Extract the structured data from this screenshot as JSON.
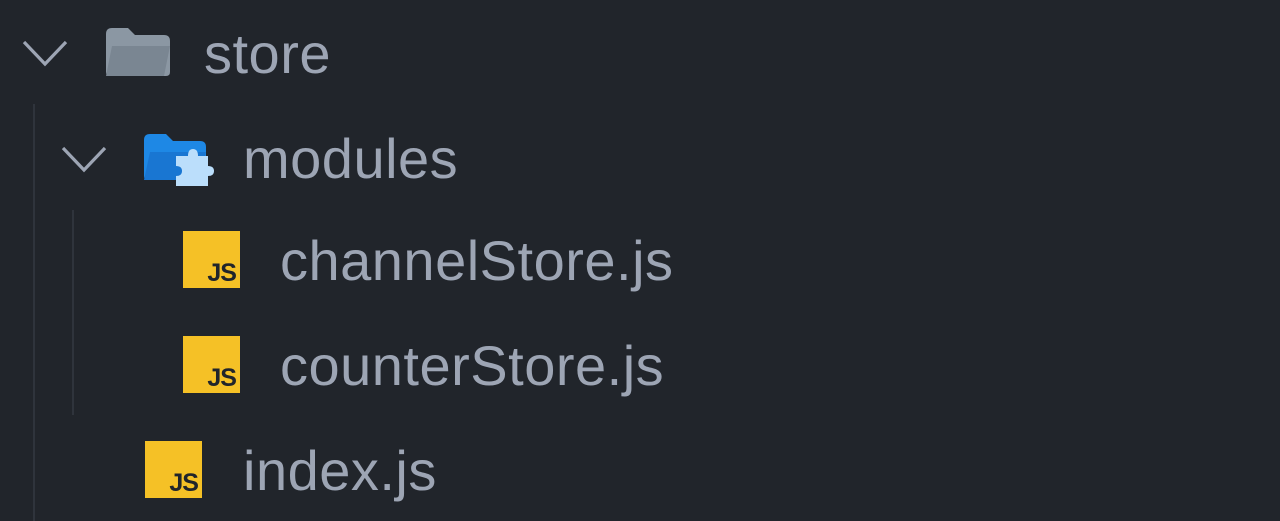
{
  "explorer": {
    "root": {
      "name": "store",
      "expanded": true,
      "icon": "folder-open-icon",
      "children": [
        {
          "name": "modules",
          "expanded": true,
          "icon": "folder-modules-icon",
          "children": [
            {
              "name": "channelStore.js",
              "icon": "js-file-icon",
              "badge": "JS"
            },
            {
              "name": "counterStore.js",
              "icon": "js-file-icon",
              "badge": "JS"
            }
          ]
        },
        {
          "name": "index.js",
          "icon": "js-file-icon",
          "badge": "JS"
        }
      ]
    }
  },
  "colors": {
    "background": "#21252b",
    "text": "#9da5b4",
    "js_badge": "#f5c126",
    "modules_folder": "#1e88e5",
    "plain_folder": "#8b97a3"
  }
}
